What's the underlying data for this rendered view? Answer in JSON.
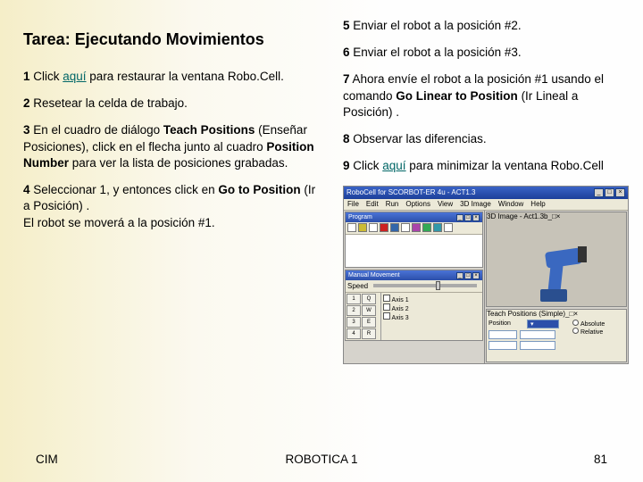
{
  "title": "Tarea: Ejecutando Movimientos",
  "left": {
    "s1a": "1",
    "s1b": " Click ",
    "s1link": "aquí",
    "s1c": " para restaurar la ventana Robo.Cell.",
    "s2a": "2",
    "s2b": " Resetear la celda de trabajo.",
    "s3a": "3",
    "s3b": " En el cuadro de diálogo ",
    "s3c": "Teach Positions",
    "s3d": " (Enseñar Posiciones), click en el flecha junto al cuadro ",
    "s3e": "Position Number",
    "s3f": " para ver la lista de posiciones grabadas.",
    "s4a": "4",
    "s4b": " Seleccionar 1, y entonces click en ",
    "s4c": "Go to Position",
    "s4d": " (Ir a Posición)              .",
    "s4e": "El robot se moverá a la posición #1."
  },
  "right": {
    "s5a": "5",
    "s5b": " Enviar el robot a la posición #2.",
    "s6a": "6",
    "s6b": " Enviar el robot a la posición #3.",
    "s7a": "7",
    "s7b": " Ahora envíe el robot a la posición #1 usando el comando ",
    "s7c": "Go Linear to Position",
    "s7d": " (Ir Lineal a Posición)              .",
    "s8a": "8",
    "s8b": " Observar las diferencias.",
    "s9a": "9",
    "s9b": " Click ",
    "s9link": "aquí",
    "s9c": " para minimizar la ventana Robo.Cell"
  },
  "app": {
    "title": "RoboCell for SCORBOT-ER 4u - ACT1.3",
    "menu": [
      "File",
      "Edit",
      "Run",
      "Options",
      "View",
      "3D Image",
      "Window",
      "Help"
    ],
    "panelProgram": "Program",
    "panelGraphic": "3D Image - Act1.3b",
    "panelManual": "Manual Movement",
    "panelTeach": "Teach Positions (Simple)",
    "speed": "Speed"
  },
  "footer": {
    "left": "CIM",
    "center": "ROBOTICA 1",
    "right": "81"
  }
}
